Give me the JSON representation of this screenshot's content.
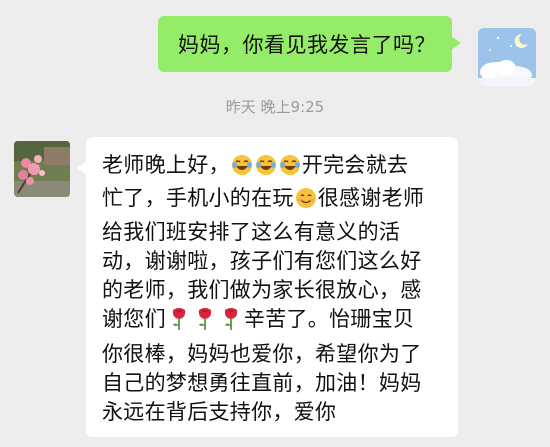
{
  "chat": {
    "outgoing": {
      "text": "妈妈，你看见我发言了吗？"
    },
    "timestamp": "昨天 晚上9:25",
    "incoming": {
      "line1a": "老师晚上好，",
      "line1b": "开完会就去",
      "line2a": "忙了，手机小的在玩",
      "line2b": "很感谢老师",
      "line3": "给我们班安排了这么有意义的活",
      "line4": "动，谢谢啦，孩子们有您们这么好",
      "line5": "的老师，我们做为家长很放心，感",
      "line6a": "谢您们",
      "line6b": "辛苦了。怡珊宝贝",
      "line7": "你很棒，妈妈也爱你，希望你为了",
      "line8": "自己的梦想勇往直前，加油！妈妈",
      "line9": "永远在背后支持你，爱你"
    }
  },
  "icons": {
    "cry_laugh": "face-with-tears-of-joy-icon",
    "smile": "smiling-face-icon",
    "rose": "rose-icon"
  },
  "colors": {
    "outgoing_bubble": "#95ec69",
    "incoming_bubble": "#ffffff",
    "background": "#ededed",
    "timestamp": "#9b9b9b"
  }
}
